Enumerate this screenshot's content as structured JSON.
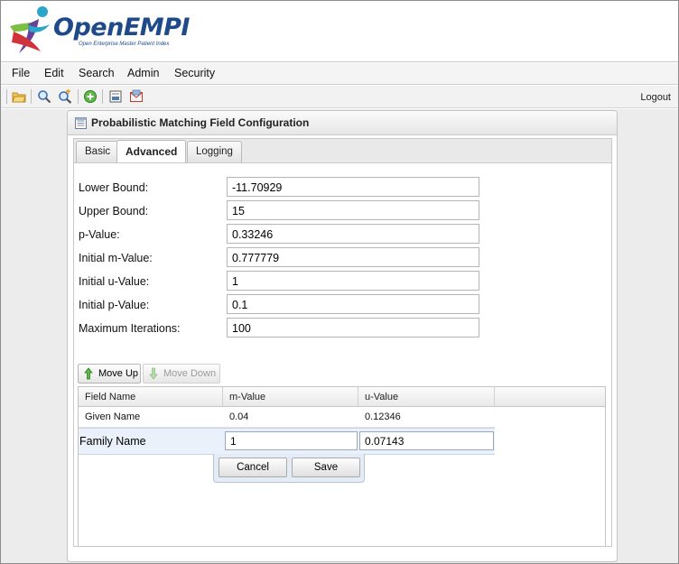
{
  "app": {
    "logo_text_1": "Open",
    "logo_text_2": "EMPI",
    "logo_tagline": "Open Enterprise Master Patient Index",
    "brand_colors": {
      "blue": "#1f4a8a",
      "green": "#7cc043",
      "red": "#d0343a",
      "purple": "#6a3f9a",
      "teal": "#2aa6c9"
    }
  },
  "menu": [
    "File",
    "Edit",
    "Search",
    "Admin",
    "Security"
  ],
  "toolbar": {
    "icons": [
      "open-folder-icon",
      "zoom-icon",
      "zoom-in-icon",
      "add-icon",
      "report-icon",
      "mail-icon"
    ],
    "logout_label": "Logout"
  },
  "panel": {
    "title": "Probabilistic Matching Field Configuration",
    "tabs": [
      "Basic",
      "Advanced",
      "Logging"
    ],
    "active_tab": "Advanced"
  },
  "form": {
    "lower_bound": {
      "label": "Lower Bound:",
      "value": "-11.70929"
    },
    "upper_bound": {
      "label": "Upper Bound:",
      "value": "15"
    },
    "p_value": {
      "label": "p-Value:",
      "value": "0.33246"
    },
    "initial_m": {
      "label": "Initial m-Value:",
      "value": "0.777779"
    },
    "initial_u": {
      "label": "Initial u-Value:",
      "value": "1"
    },
    "initial_p": {
      "label": "Initial p-Value:",
      "value": "0.1"
    },
    "max_iter": {
      "label": "Maximum Iterations:",
      "value": "100"
    }
  },
  "grid": {
    "move_up_label": "Move Up",
    "move_down_label": "Move Down",
    "columns": [
      "Field Name",
      "m-Value",
      "u-Value"
    ],
    "rows": [
      {
        "field": "Given Name",
        "m": "0.04",
        "u": "0.12346"
      }
    ],
    "editor": {
      "field": "Family Name",
      "m": "1",
      "u": "0.07143"
    },
    "cancel_label": "Cancel",
    "save_label": "Save"
  }
}
